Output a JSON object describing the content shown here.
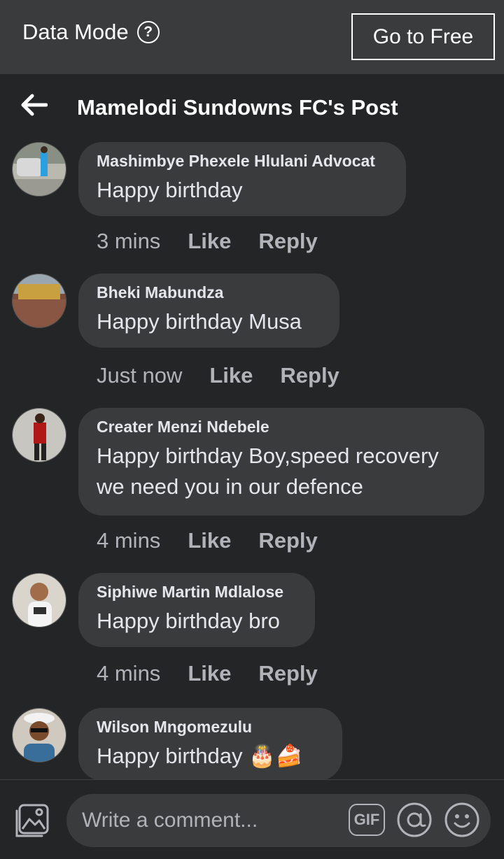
{
  "data_mode_bar": {
    "label": "Data Mode",
    "help_icon": "?",
    "go_free_label": "Go to Free"
  },
  "header": {
    "back_icon": "arrow-left-icon",
    "title": "Mamelodi Sundowns FC's Post"
  },
  "comments": [
    {
      "author": "Mashimbye Phexele Hlulani Advocat",
      "text": "Happy birthday",
      "time": "3 mins",
      "like": "Like",
      "reply": "Reply"
    },
    {
      "author": "Bheki Mabundza",
      "text": "Happy birthday Musa",
      "time": "Just now",
      "like": "Like",
      "reply": "Reply"
    },
    {
      "author": "Creater Menzi Ndebele",
      "text_line1": "Happy birthday Boy,speed recovery",
      "text_line2": "we need you in our defence",
      "time": "4 mins",
      "like": "Like",
      "reply": "Reply"
    },
    {
      "author": "Siphiwe Martin Mdlalose",
      "text": "Happy birthday bro",
      "time": "4 mins",
      "like": "Like",
      "reply": "Reply"
    },
    {
      "author": "Wilson Mngomezulu",
      "text": "Happy birthday 🎂🍰"
    }
  ],
  "composer": {
    "photo_icon": "photo-icon",
    "placeholder": "Write a comment...",
    "gif_label": "GIF",
    "at_icon": "mention-icon",
    "emoji_icon": "emoji-icon"
  },
  "colors": {
    "background": "#242526",
    "bar": "#3a3b3c",
    "bubble": "#3a3b3c",
    "meta_text": "#b0b3b8"
  }
}
